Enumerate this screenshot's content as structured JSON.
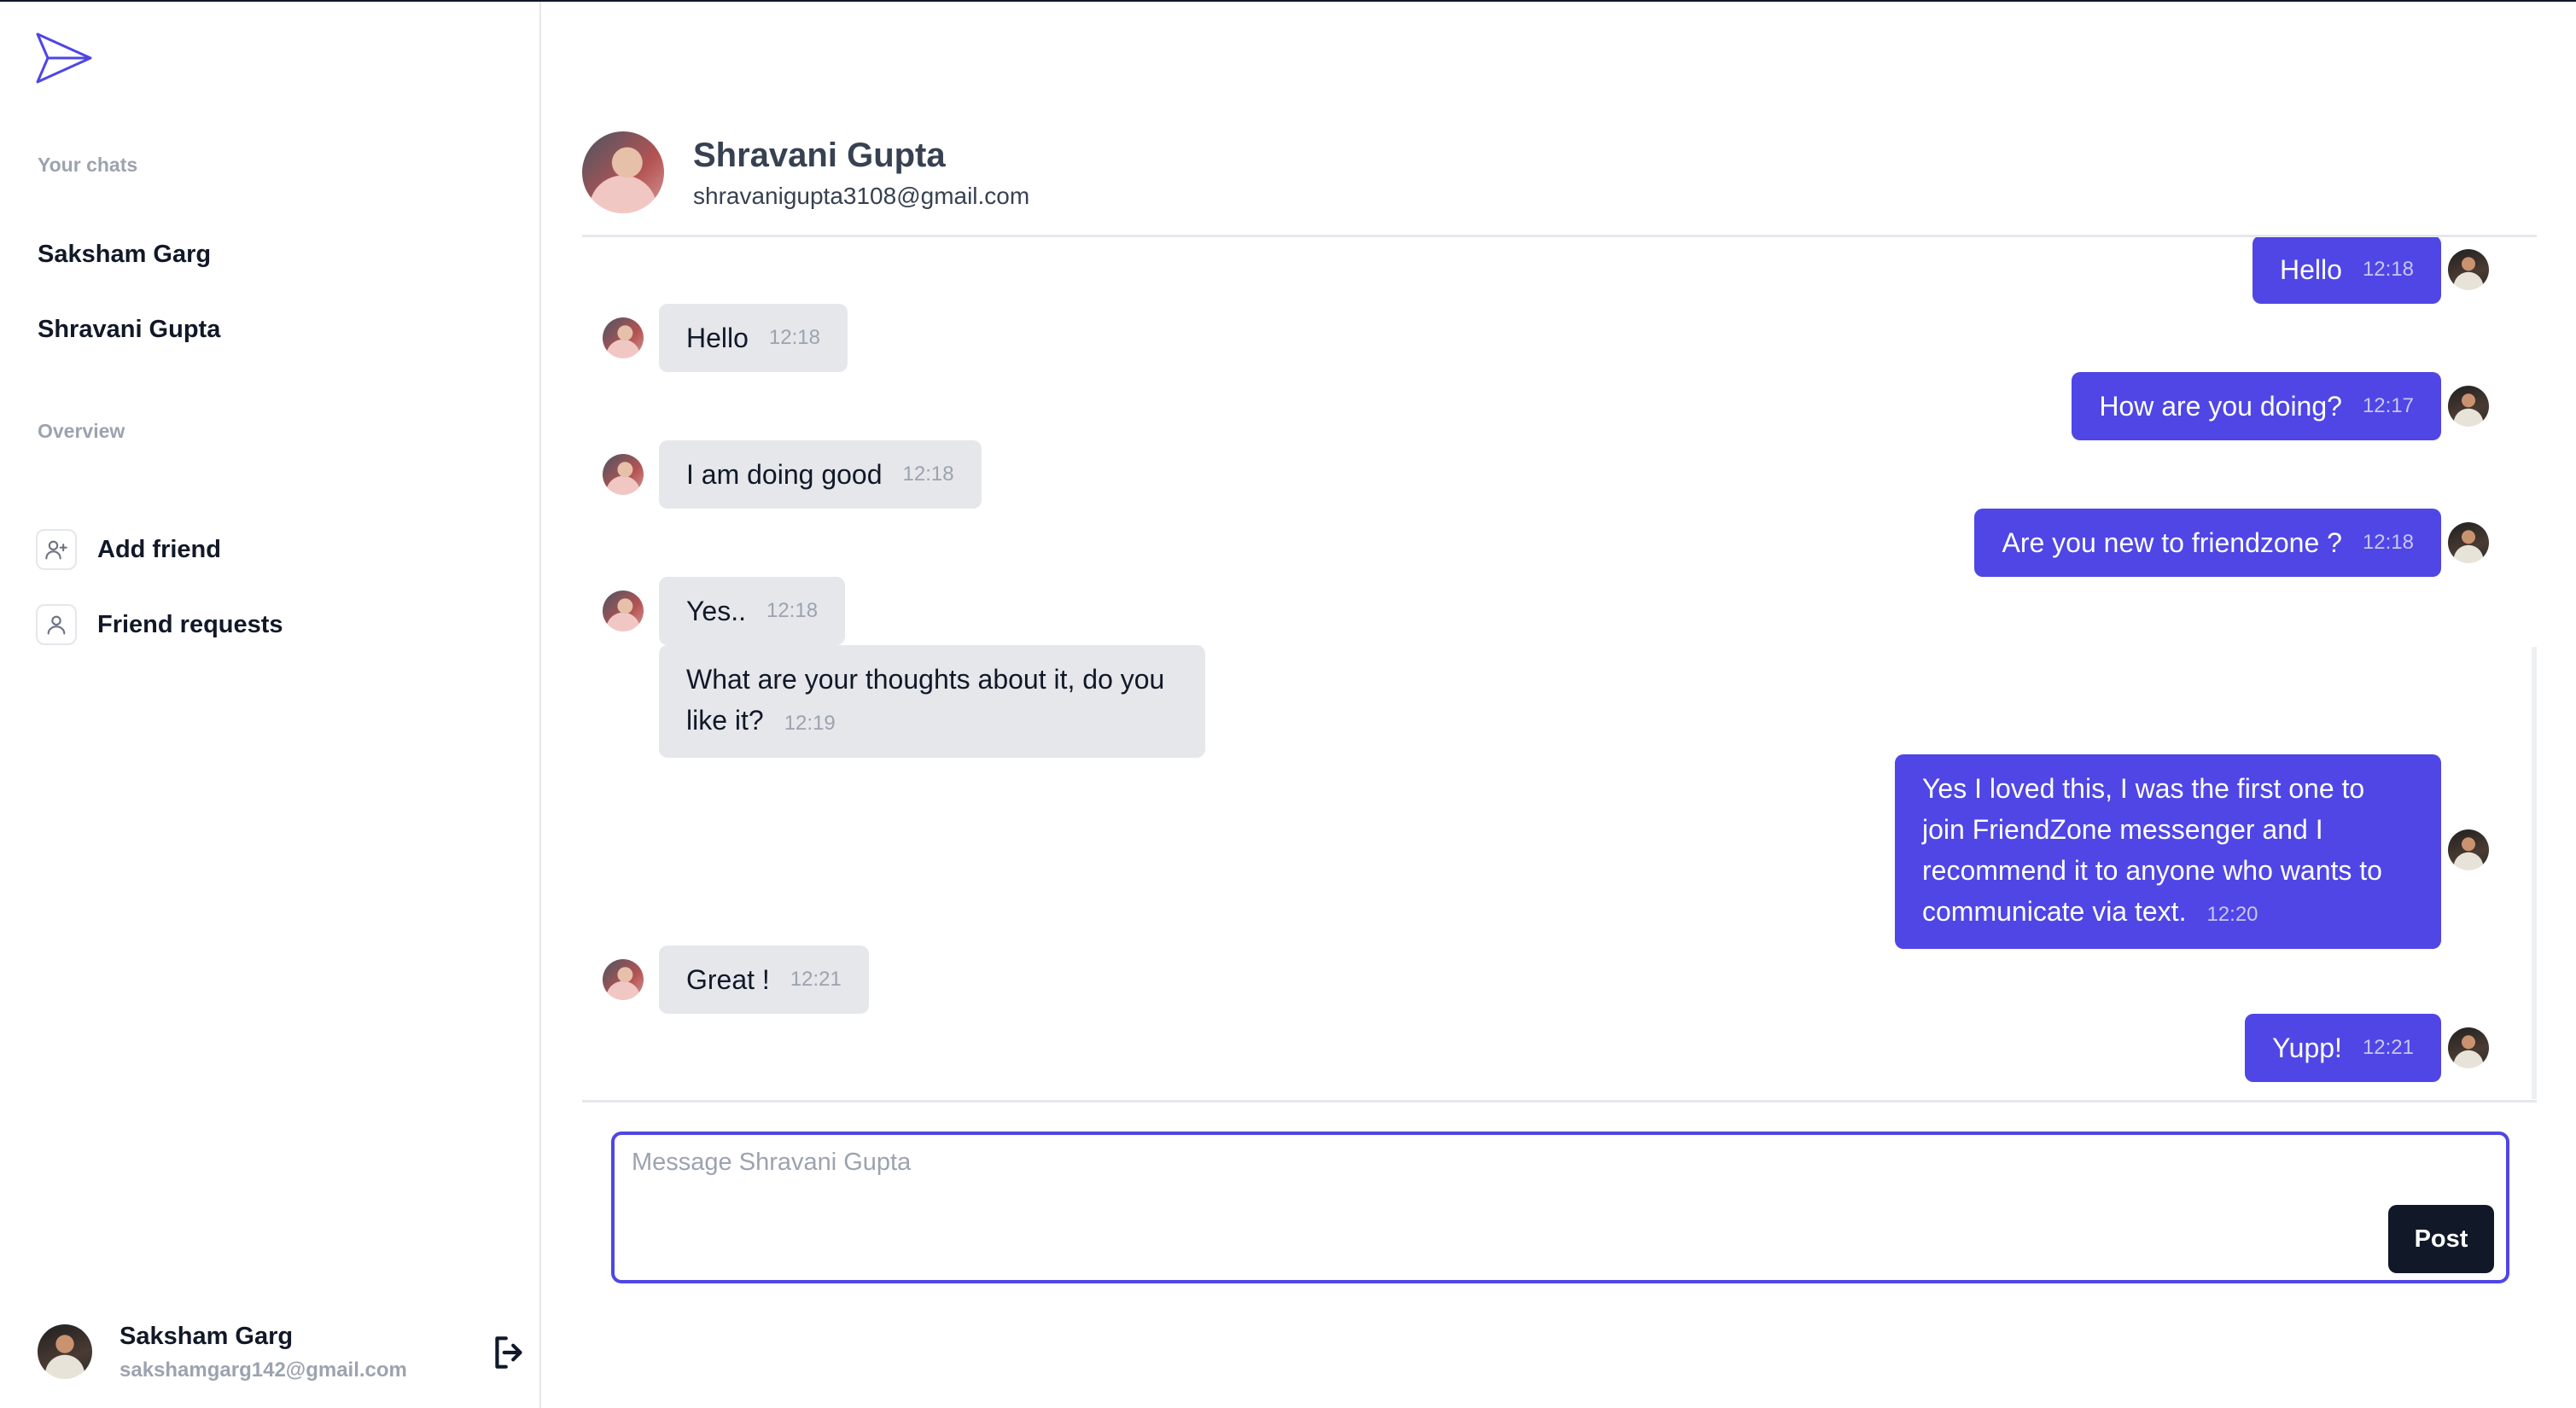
{
  "sidebar": {
    "chats_label": "Your chats",
    "chats": [
      {
        "name": "Saksham Garg"
      },
      {
        "name": "Shravani Gupta"
      }
    ],
    "overview_label": "Overview",
    "overview_items": [
      {
        "label": "Add friend",
        "icon": "user-plus-icon"
      },
      {
        "label": "Friend requests",
        "icon": "user-icon"
      }
    ]
  },
  "current_user": {
    "name": "Saksham Garg",
    "email": "sakshamgarg142@gmail.com"
  },
  "chat_partner": {
    "name": "Shravani Gupta",
    "email": "shravanigupta3108@gmail.com"
  },
  "messages": [
    {
      "from": "me",
      "text": "Hello",
      "time": "12:18"
    },
    {
      "from": "them",
      "text": "Hello",
      "time": "12:18"
    },
    {
      "from": "me",
      "text": "How are you doing?",
      "time": "12:17"
    },
    {
      "from": "them",
      "text": "I am doing good",
      "time": "12:18"
    },
    {
      "from": "me",
      "text": "Are you new to friendzone ?",
      "time": "12:18"
    },
    {
      "from": "them",
      "text": "Yes..",
      "time": "12:18"
    },
    {
      "from": "them",
      "text": "What are your thoughts about it, do you like it?",
      "time": "12:19"
    },
    {
      "from": "me",
      "text": "Yes I loved this, I was the first one to join FriendZone messenger and I recommend it to anyone who wants to communicate via text.",
      "time": "12:20"
    },
    {
      "from": "them",
      "text": "Great !",
      "time": "12:21"
    },
    {
      "from": "me",
      "text": "Yupp!",
      "time": "12:21"
    }
  ],
  "composer": {
    "placeholder": "Message Shravani Gupta",
    "value": "",
    "post_label": "Post"
  },
  "colors": {
    "accent": "#4f46e5",
    "incoming_bubble": "#e5e7eb",
    "post_button": "#111827"
  }
}
